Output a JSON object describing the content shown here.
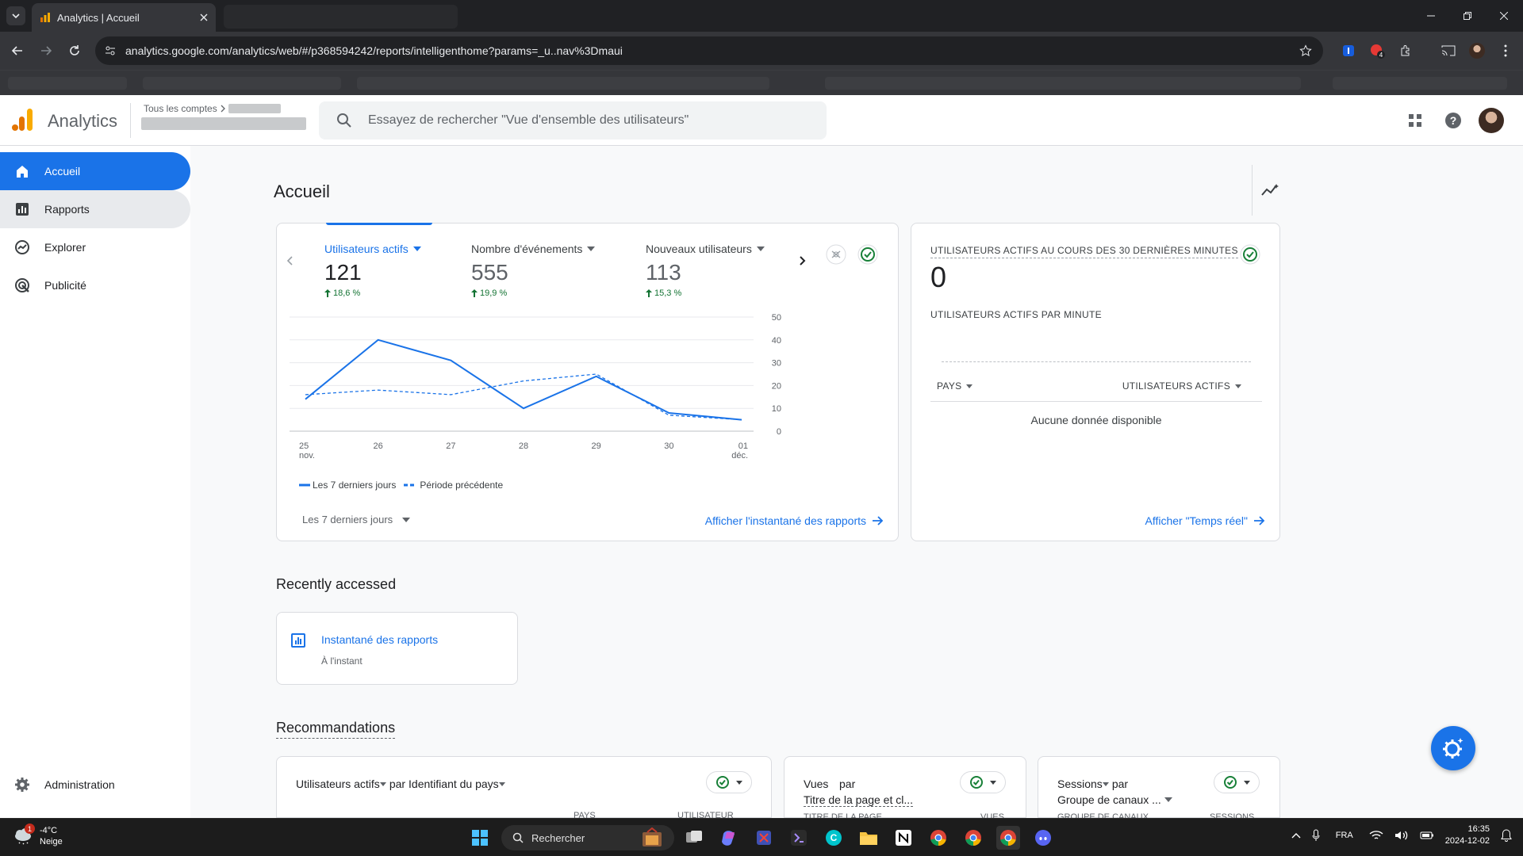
{
  "browser": {
    "tab_title": "Analytics | Accueil",
    "url": "analytics.google.com/analytics/web/#/p368594242/reports/intelligenthome?params=_u..nav%3Dmaui"
  },
  "header": {
    "app_name": "Analytics",
    "account_crumb": "Tous les comptes",
    "search_placeholder": "Essayez de rechercher \"Vue d'ensemble des utilisateurs\""
  },
  "sidebar": {
    "items": [
      {
        "label": "Accueil",
        "icon": "home-icon"
      },
      {
        "label": "Rapports",
        "icon": "bar-chart-icon"
      },
      {
        "label": "Explorer",
        "icon": "explore-icon"
      },
      {
        "label": "Publicité",
        "icon": "ads-icon"
      }
    ],
    "admin_label": "Administration"
  },
  "main": {
    "title": "Accueil"
  },
  "overview": {
    "metrics": [
      {
        "label": "Utilisateurs actifs",
        "value": "121",
        "delta": "18,6 %"
      },
      {
        "label": "Nombre d'événements",
        "value": "555",
        "delta": "19,9 %"
      },
      {
        "label": "Nouveaux utilisateurs",
        "value": "113",
        "delta": "15,3 %"
      }
    ],
    "date_range": "Les 7 derniers jours",
    "link": "Afficher l'instantané des rapports"
  },
  "chart_data": {
    "type": "line",
    "x": [
      "25 nov.",
      "26",
      "27",
      "28",
      "29",
      "30",
      "01 déc."
    ],
    "x_labels": [
      {
        "top": "25",
        "bottom": "nov."
      },
      {
        "top": "26",
        "bottom": ""
      },
      {
        "top": "27",
        "bottom": ""
      },
      {
        "top": "28",
        "bottom": ""
      },
      {
        "top": "29",
        "bottom": ""
      },
      {
        "top": "30",
        "bottom": ""
      },
      {
        "top": "01",
        "bottom": "déc."
      }
    ],
    "ylim": [
      0,
      50
    ],
    "yticks": [
      0,
      10,
      20,
      30,
      40,
      50
    ],
    "grid": true,
    "legend_position": "bottom-left",
    "series": [
      {
        "name": "Les 7 derniers jours",
        "values": [
          14,
          40,
          31,
          10,
          24,
          8,
          5
        ],
        "style": "solid",
        "color": "#1a73e8"
      },
      {
        "name": "Période précédente",
        "values": [
          16,
          18,
          16,
          22,
          25,
          7,
          5
        ],
        "style": "dashed",
        "color": "#1a73e8"
      }
    ]
  },
  "realtime": {
    "title": "UTILISATEURS ACTIFS AU COURS DES 30 DERNIÈRES MINUTES",
    "value": "0",
    "per_minute_label": "UTILISATEURS ACTIFS PAR MINUTE",
    "col_country": "PAYS",
    "col_users": "UTILISATEURS ACTIFS",
    "empty": "Aucune donnée disponible",
    "link": "Afficher \"Temps réel\""
  },
  "recent": {
    "title": "Recently accessed",
    "items": [
      {
        "title": "Instantané des rapports",
        "subtitle": "À l'instant"
      }
    ]
  },
  "recommendations": {
    "title": "Recommandations",
    "cards": [
      {
        "metric": "Utilisateurs actifs",
        "by": "par",
        "dimension": "Identifiant du pays",
        "col_left": "PAYS",
        "col_right": "UTILISATEUR"
      },
      {
        "metric": "Vues",
        "by": "par",
        "dimension": "Titre de la page et cl...",
        "col_left": "TITRE DE LA PAGE",
        "col_right": "VUES"
      },
      {
        "metric": "Sessions",
        "by": "par",
        "dimension": "Groupe de canaux ...",
        "col_left": "GROUPE DE CANAUX",
        "col_right": "SESSIONS"
      }
    ]
  },
  "taskbar": {
    "weather_temp": "-4°C",
    "weather_desc": "Neige",
    "weather_badge": "1",
    "search_placeholder": "Rechercher",
    "lang": "FRA",
    "time": "16:35",
    "date": "2024-12-02"
  },
  "colors": {
    "accent": "#1a73e8",
    "positive": "#137333",
    "ga_orange": "#f9ab00",
    "ga_dark_orange": "#e37400"
  }
}
